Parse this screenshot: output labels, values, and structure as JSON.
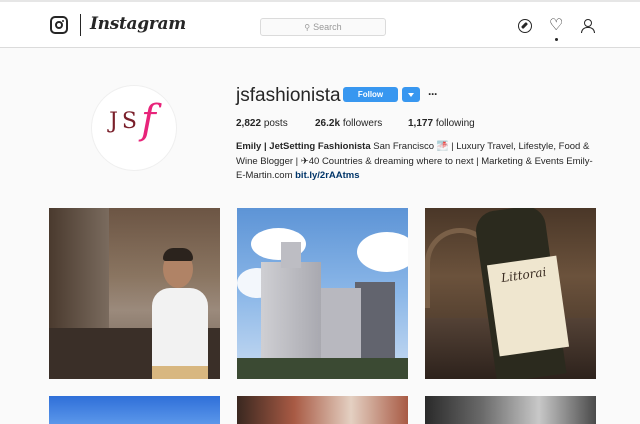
{
  "nav": {
    "wordmark": "Instagram",
    "search_placeholder": "Search",
    "icons": [
      "instagram-glyph-icon",
      "compass-icon",
      "heart-icon",
      "user-icon"
    ]
  },
  "profile": {
    "username": "jsfashionista",
    "avatar_text_left": "JS",
    "avatar_text_right": "f",
    "follow_label": "Follow",
    "more_label": "···",
    "stats": {
      "posts_count": "2,822",
      "posts_label": "posts",
      "followers_count": "26.2k",
      "followers_label": "followers",
      "following_count": "1,177",
      "following_label": "following"
    },
    "bio": {
      "name": "Emily | JetSetting Fashionista",
      "text": " San Francisco 🌁 | Luxury Travel, Lifestyle, Food & Wine Blogger | ✈40 Countries & dreaming where to next | Marketing & Events Emily-E-Martin.com ",
      "link": "bit.ly/2rAAtms"
    },
    "wine_label_text": "Littorai"
  },
  "colors": {
    "accent": "#3897f0",
    "avatar_dark": "#7a1f2a",
    "avatar_pink": "#e8247a",
    "link": "#003569"
  }
}
